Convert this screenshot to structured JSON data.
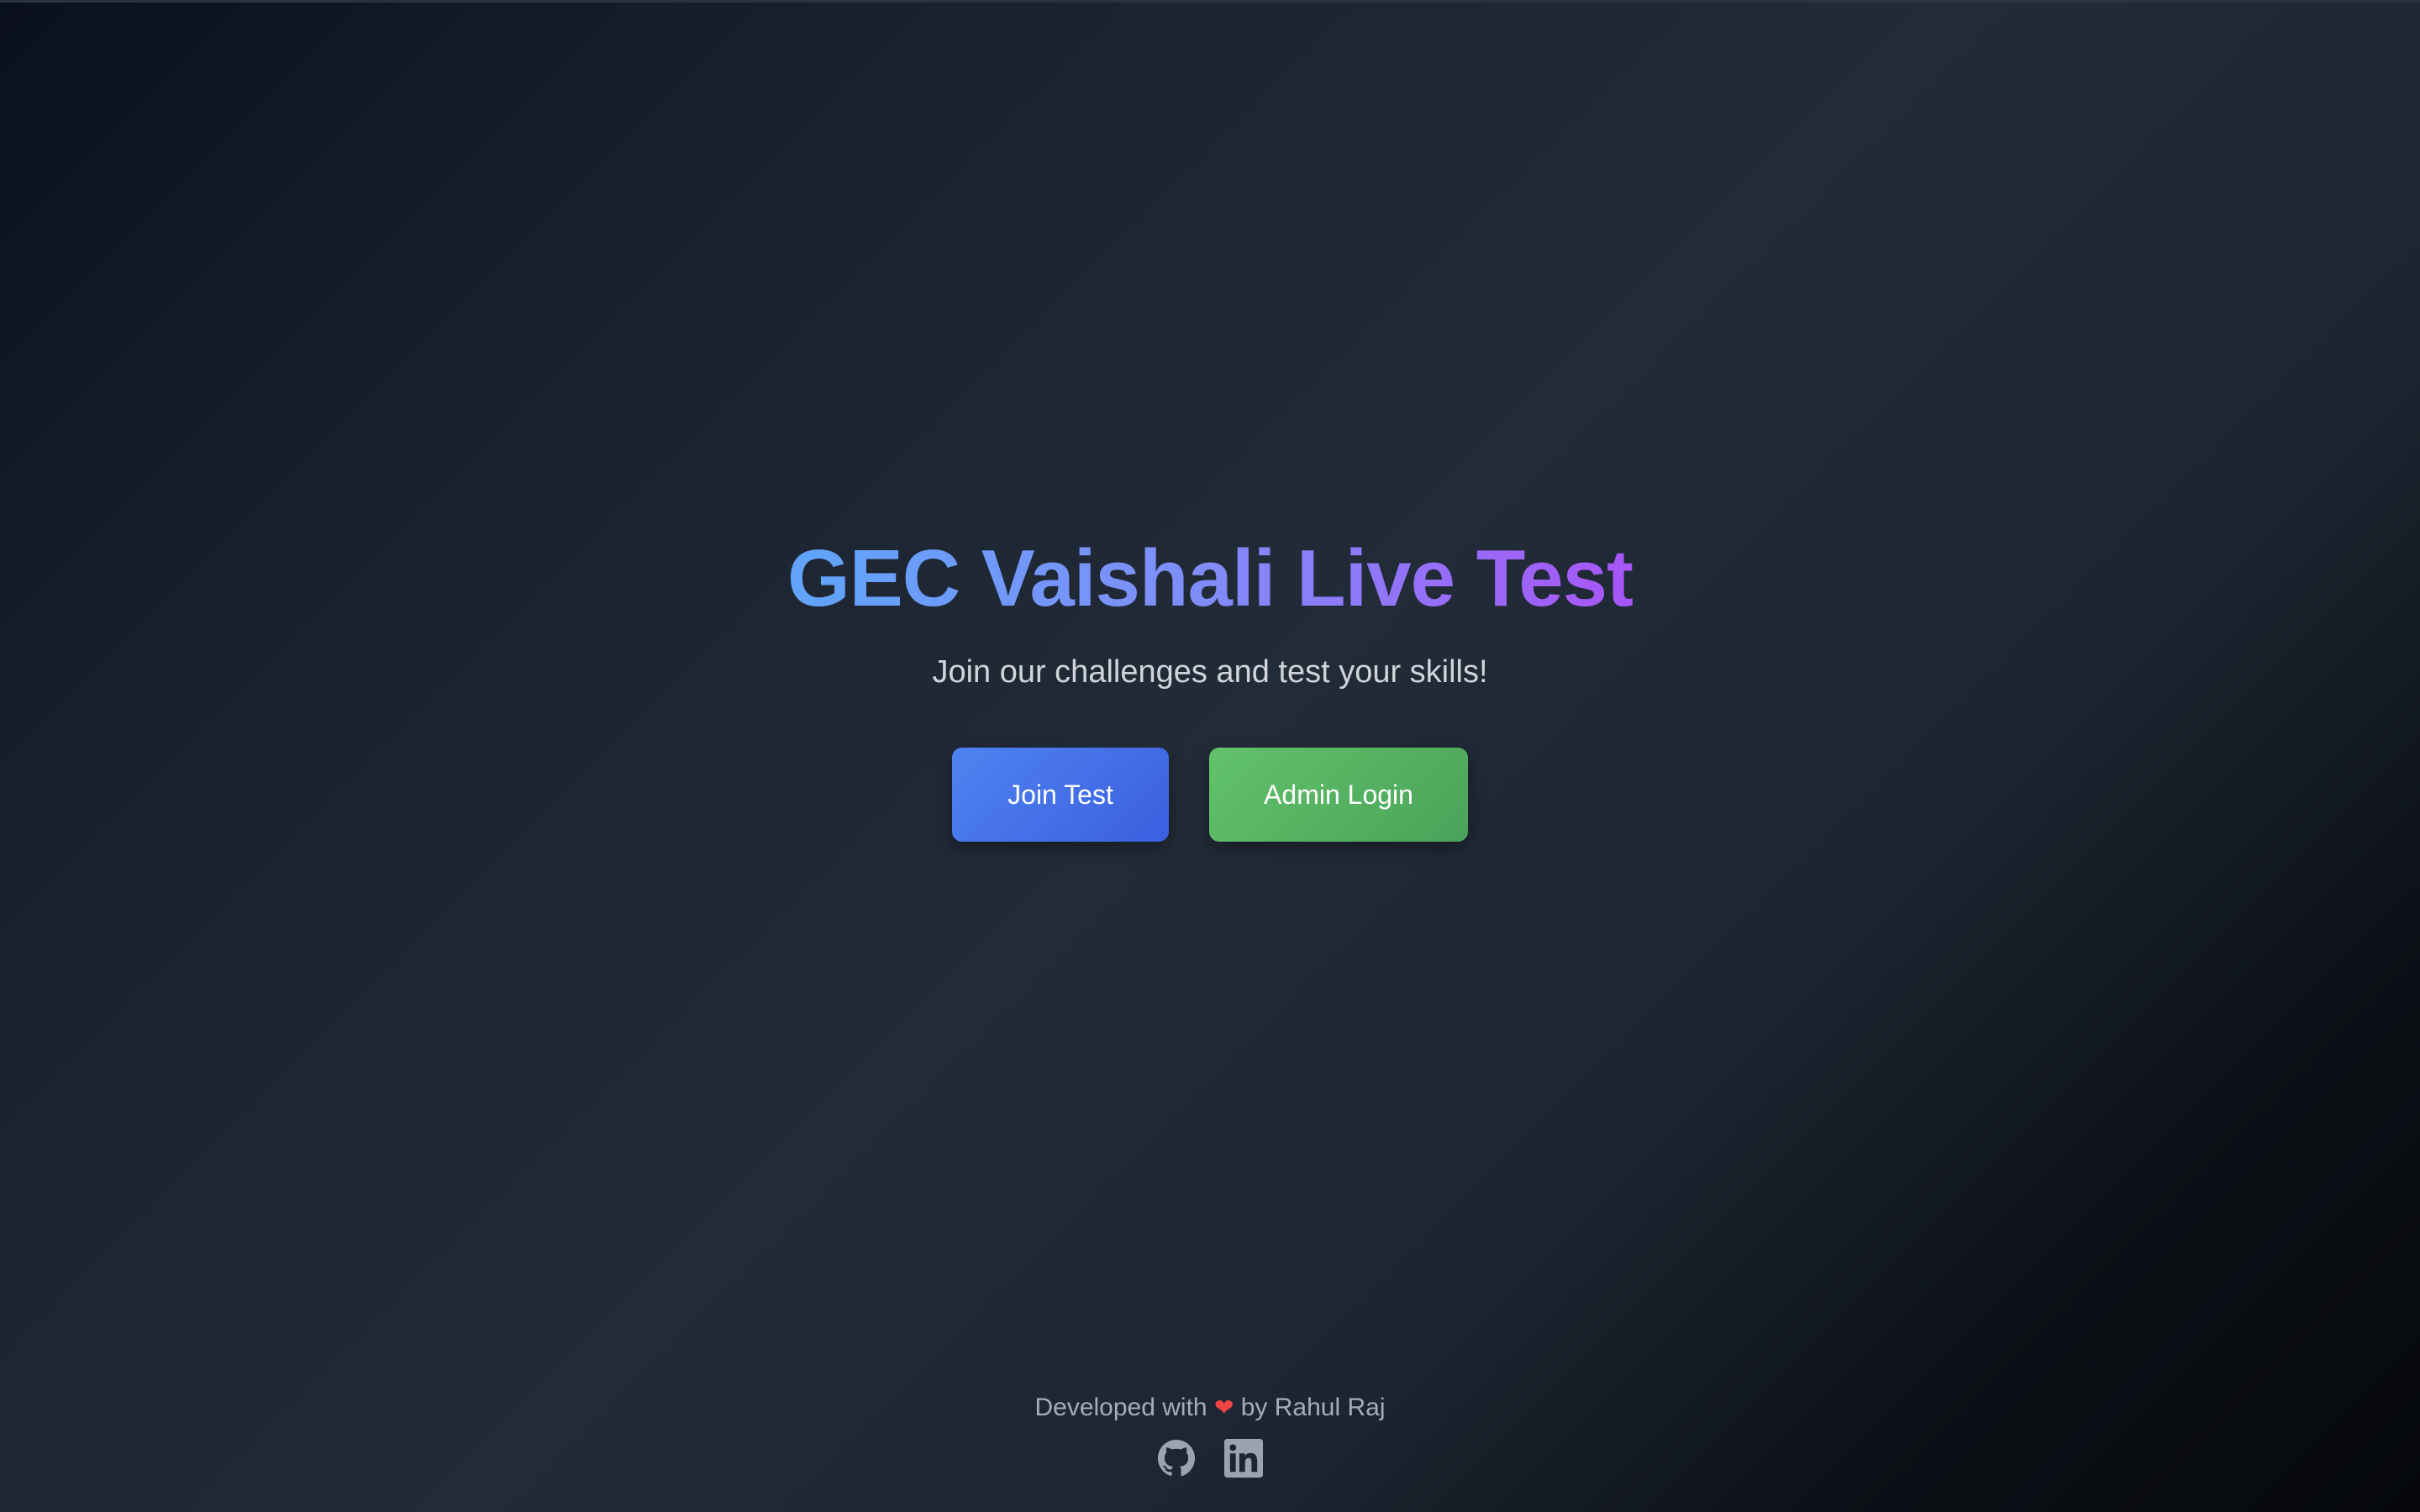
{
  "hero": {
    "title": "GEC Vaishali Live Test",
    "subtitle": "Join our challenges and test your skills!"
  },
  "actions": {
    "join_label": "Join Test",
    "admin_label": "Admin Login"
  },
  "footer": {
    "prefix": "Developed with",
    "heart": "❤",
    "suffix": "by Rahul Raj",
    "socials": [
      {
        "icon": "github-icon"
      },
      {
        "icon": "linkedin-icon"
      }
    ]
  },
  "colors": {
    "title_gradient_start": "#60a5fa",
    "title_gradient_end": "#a855f7",
    "join_button": "#3b5fe0",
    "admin_button": "#4aa35a",
    "background": "#1a2230"
  }
}
